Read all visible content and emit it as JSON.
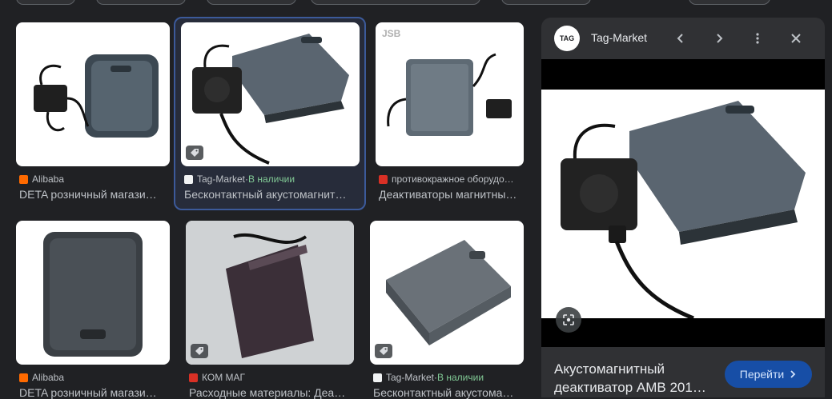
{
  "results": [
    {
      "source": "Alibaba",
      "stock": "",
      "title": "DETA розничный магази…",
      "favicon_color": "#ff6a00"
    },
    {
      "source": "Tag-Market",
      "separator": " · ",
      "stock": "В наличии",
      "title": "Бесконтактный акустомагнит…",
      "favicon_color": "#f1f3f4",
      "selected": true
    },
    {
      "source": "противокражное оборудо…",
      "stock": "",
      "title": "Деактиваторы магнитны…",
      "favicon_color": "#d93025"
    },
    {
      "source": "Alibaba",
      "stock": "",
      "title": "DETA розничный магази…",
      "favicon_color": "#ff6a00"
    },
    {
      "source": "КОМ МАГ",
      "stock": "",
      "title": "Расходные материалы: Деа…",
      "favicon_color": "#d93025"
    },
    {
      "source": "Tag-Market",
      "separator": " · ",
      "stock": "В наличии",
      "title": "Бесконтактный акустома…",
      "favicon_color": "#f1f3f4"
    }
  ],
  "preview": {
    "site": "Tag-Market",
    "logo_text": "TAG",
    "title": "Акустомагнитный деактиватор AMB 201…",
    "visit_label": "Перейти",
    "accent": "#174ea6"
  },
  "icons": {
    "prev": "chevron-left-icon",
    "next": "chevron-right-icon",
    "more": "more-vert-icon",
    "close": "close-icon",
    "lens": "lens-icon",
    "tag": "tag-icon"
  },
  "watermark": "JSB"
}
